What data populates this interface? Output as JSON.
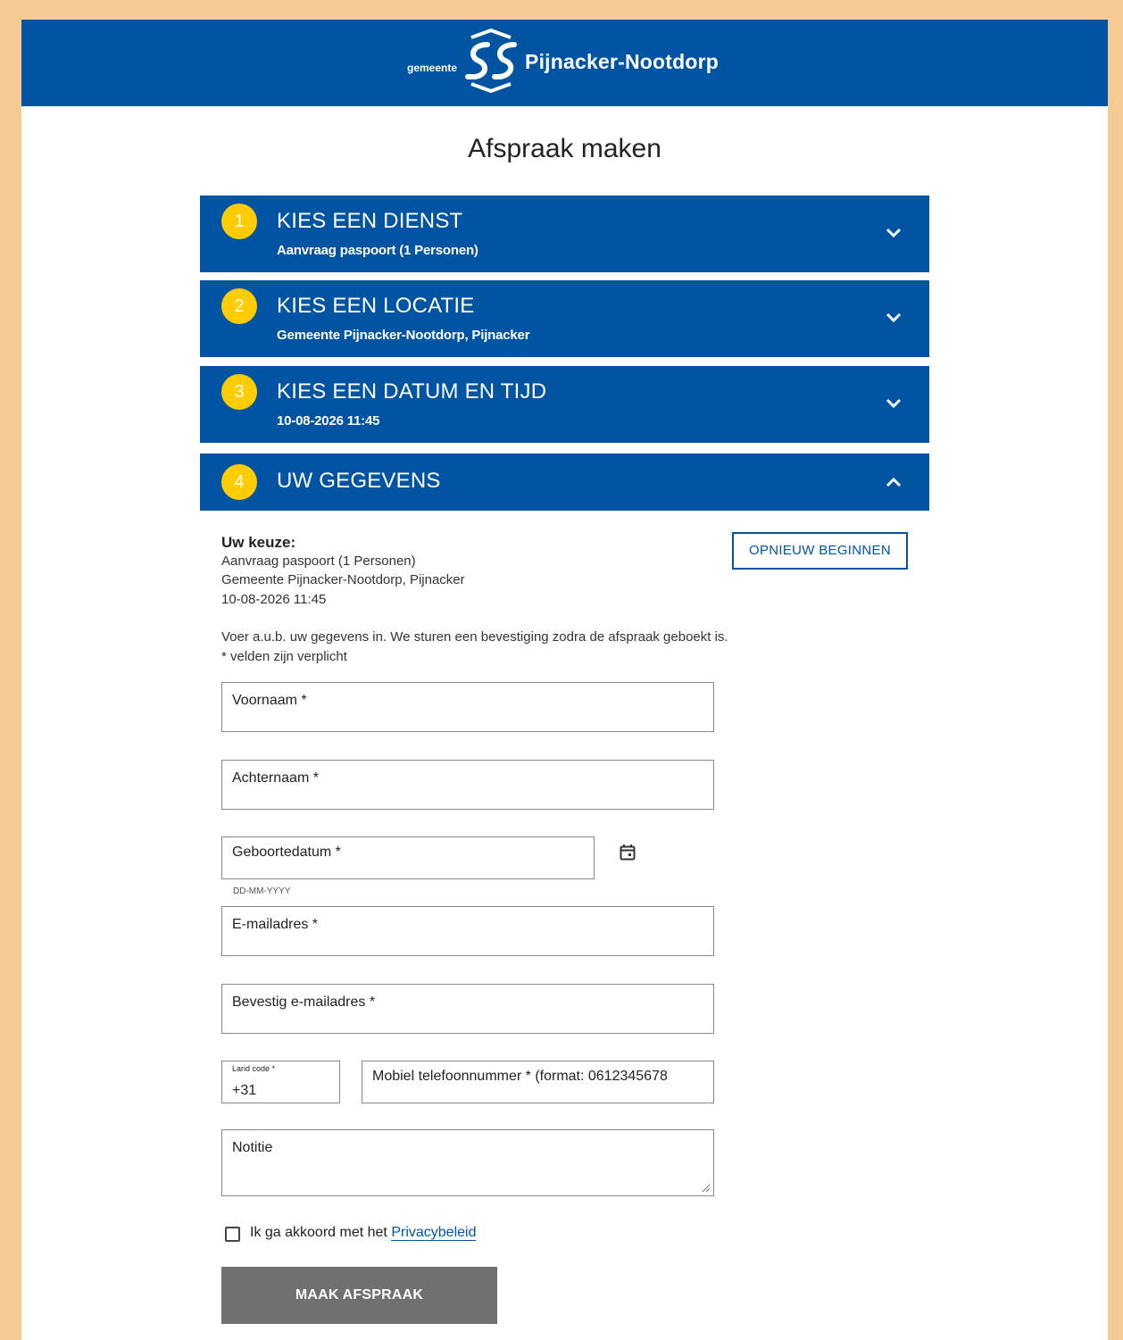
{
  "header": {
    "logo_small": "gemeente",
    "logo_big": "Pijnacker-Nootdorp"
  },
  "page_title": "Afspraak maken",
  "steps": [
    {
      "num": "1",
      "title": "KIES EEN DIENST",
      "subtitle": "Aanvraag paspoort (1 Personen)",
      "state": "collapsed"
    },
    {
      "num": "2",
      "title": "KIES EEN LOCATIE",
      "subtitle": "Gemeente Pijnacker-Nootdorp, Pijnacker",
      "state": "collapsed"
    },
    {
      "num": "3",
      "title": "KIES EEN DATUM EN TIJD",
      "subtitle": "10-08-2026 11:45",
      "state": "collapsed"
    },
    {
      "num": "4",
      "title": "UW GEGEVENS",
      "subtitle": "",
      "state": "expanded"
    }
  ],
  "choice": {
    "title": "Uw keuze:",
    "lines": [
      "Aanvraag paspoort (1 Personen)",
      "Gemeente Pijnacker-Nootdorp, Pijnacker",
      "10-08-2026 11:45"
    ],
    "restart_label": "OPNIEUW BEGINNEN"
  },
  "info": {
    "line1": "Voer a.u.b. uw gegevens in. We sturen een bevestiging zodra de afspraak geboekt is.",
    "line2": "* velden zijn verplicht"
  },
  "form": {
    "first_name": "Voornaam *",
    "last_name": "Achternaam *",
    "birthdate": "Geboortedatum *",
    "birthdate_hint": "DD-MM-YYYY",
    "email": "E-mailadres *",
    "email_confirm": "Bevestig e-mailadres *",
    "country_code_label": "Land code *",
    "country_code_value": "+31",
    "mobile": "Mobiel telefoonnummer * (format: 0612345678",
    "note": "Notitie",
    "agree_text": "Ik ga akkoord met het ",
    "privacy_link": "Privacybeleid",
    "submit_label": "MAAK AFSPRAAK"
  },
  "colors": {
    "brand_blue": "#0054a2",
    "step_badge": "#ffcc00",
    "frame_border": "#f5cb93",
    "submit_disabled": "#707070"
  },
  "icons": {
    "chevron_collapsed": "chevron-down-icon",
    "chevron_expanded": "chevron-up-icon",
    "calendar": "calendar-icon"
  }
}
